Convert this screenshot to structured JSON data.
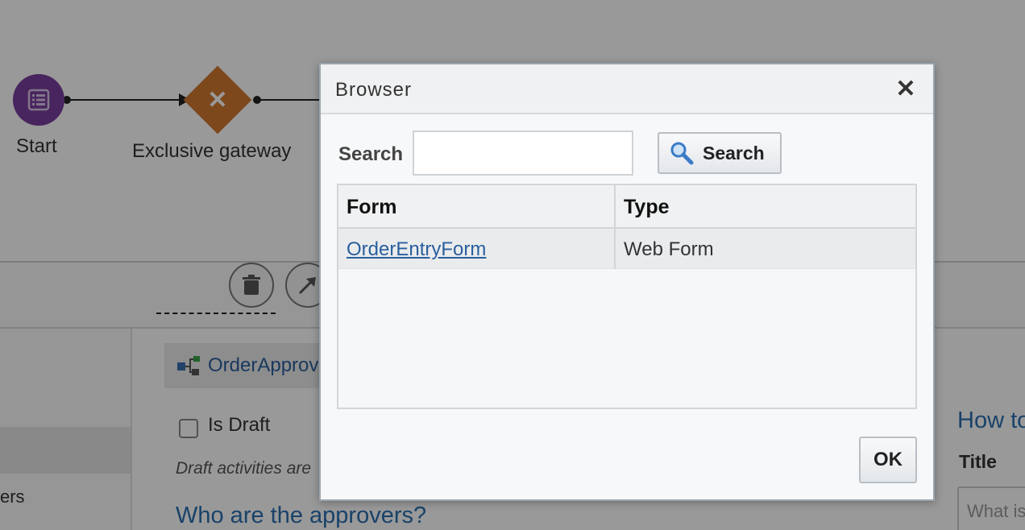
{
  "canvas": {
    "start_label": "Start",
    "gateway_label": "Exclusive gateway"
  },
  "details": {
    "process_name": "OrderApprov",
    "is_draft_label": "Is Draft",
    "draft_note": "Draft activities are",
    "approvers_heading": "Who are the approvers?",
    "left_panel_text": "ers",
    "how_to_heading": "How to",
    "title_label": "Title",
    "title_placeholder": "What is"
  },
  "dialog": {
    "title": "Browser",
    "search_label": "Search",
    "search_value": "",
    "search_button": "Search",
    "columns": [
      "Form",
      "Type"
    ],
    "rows": [
      {
        "form": "OrderEntryForm",
        "type": "Web Form"
      }
    ],
    "ok_button": "OK"
  },
  "colors": {
    "start_node": "#7b3f9e",
    "gateway": "#d0782e",
    "link": "#2a5f9e",
    "overlay": "rgba(0,0,0,0.40)"
  },
  "icons": [
    "list-icon",
    "x-icon",
    "trash-icon",
    "arrow-icon",
    "process-icon",
    "search-icon",
    "close-icon"
  ]
}
